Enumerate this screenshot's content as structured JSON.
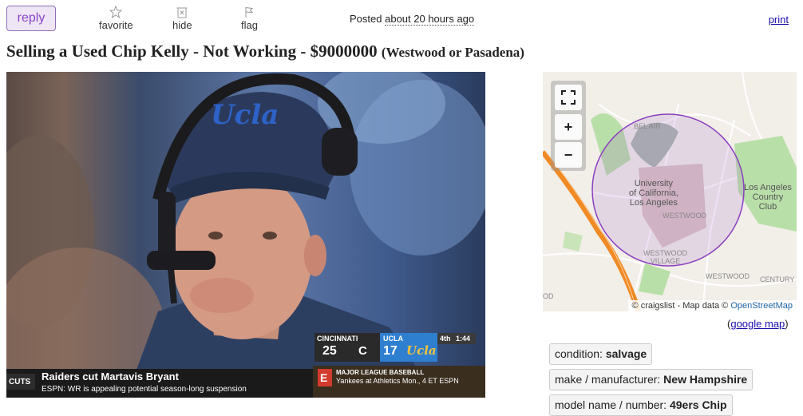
{
  "actions": {
    "reply": "reply",
    "favorite": "favorite",
    "hide": "hide",
    "flag": "flag",
    "posted_prefix": "Posted",
    "posted_ago": "about 20 hours ago",
    "print": "print"
  },
  "posting": {
    "title": "Selling a Used Chip Kelly - Not Working - $9000000",
    "location": "(Westwood or Pasadena)"
  },
  "photo": {
    "cap_logo": "Ucla",
    "scoreboard": {
      "team1": "CINCINNATI",
      "team1_score": "25",
      "team1_logo": "C",
      "team2": "UCLA",
      "team2_score": "17",
      "team2_logo": "Ucla",
      "quarter": "4th",
      "clock": "1:44"
    },
    "ticker": {
      "tag": "CUTS",
      "headline": "Raiders cut Martavis Bryant",
      "sub": "ESPN: WR is appealing potential season-long suspension",
      "logo": "E",
      "league": "MAJOR LEAGUE BASEBALL",
      "game": "Yankees at Athletics Mon., 4 ET ESPN"
    }
  },
  "map": {
    "zoom_in": "+",
    "zoom_out": "−",
    "labels": {
      "bel_air": "BEL AIR",
      "university": "University\nof California,\nLos Angeles",
      "westwood1": "WESTWOOD",
      "westwood_village": "WESTWOOD\nVILLAGE",
      "westwood2": "WESTWOOD",
      "century": "CENTURY",
      "country_club": "Los Angeles\nCountry\nClub",
      "od": "OD"
    },
    "attribution_prefix": "© craigslist - Map data ©",
    "attribution_link": "OpenStreetMap",
    "google_map": "google map",
    "colors": {
      "circle": "#8a3fbf",
      "road": "#f08a24",
      "park": "#b9dfa8"
    }
  },
  "attributes": [
    {
      "label": "condition:",
      "value": "salvage"
    },
    {
      "label": "make / manufacturer:",
      "value": "New Hampshire"
    },
    {
      "label": "model name / number:",
      "value": "49ers Chip"
    }
  ]
}
